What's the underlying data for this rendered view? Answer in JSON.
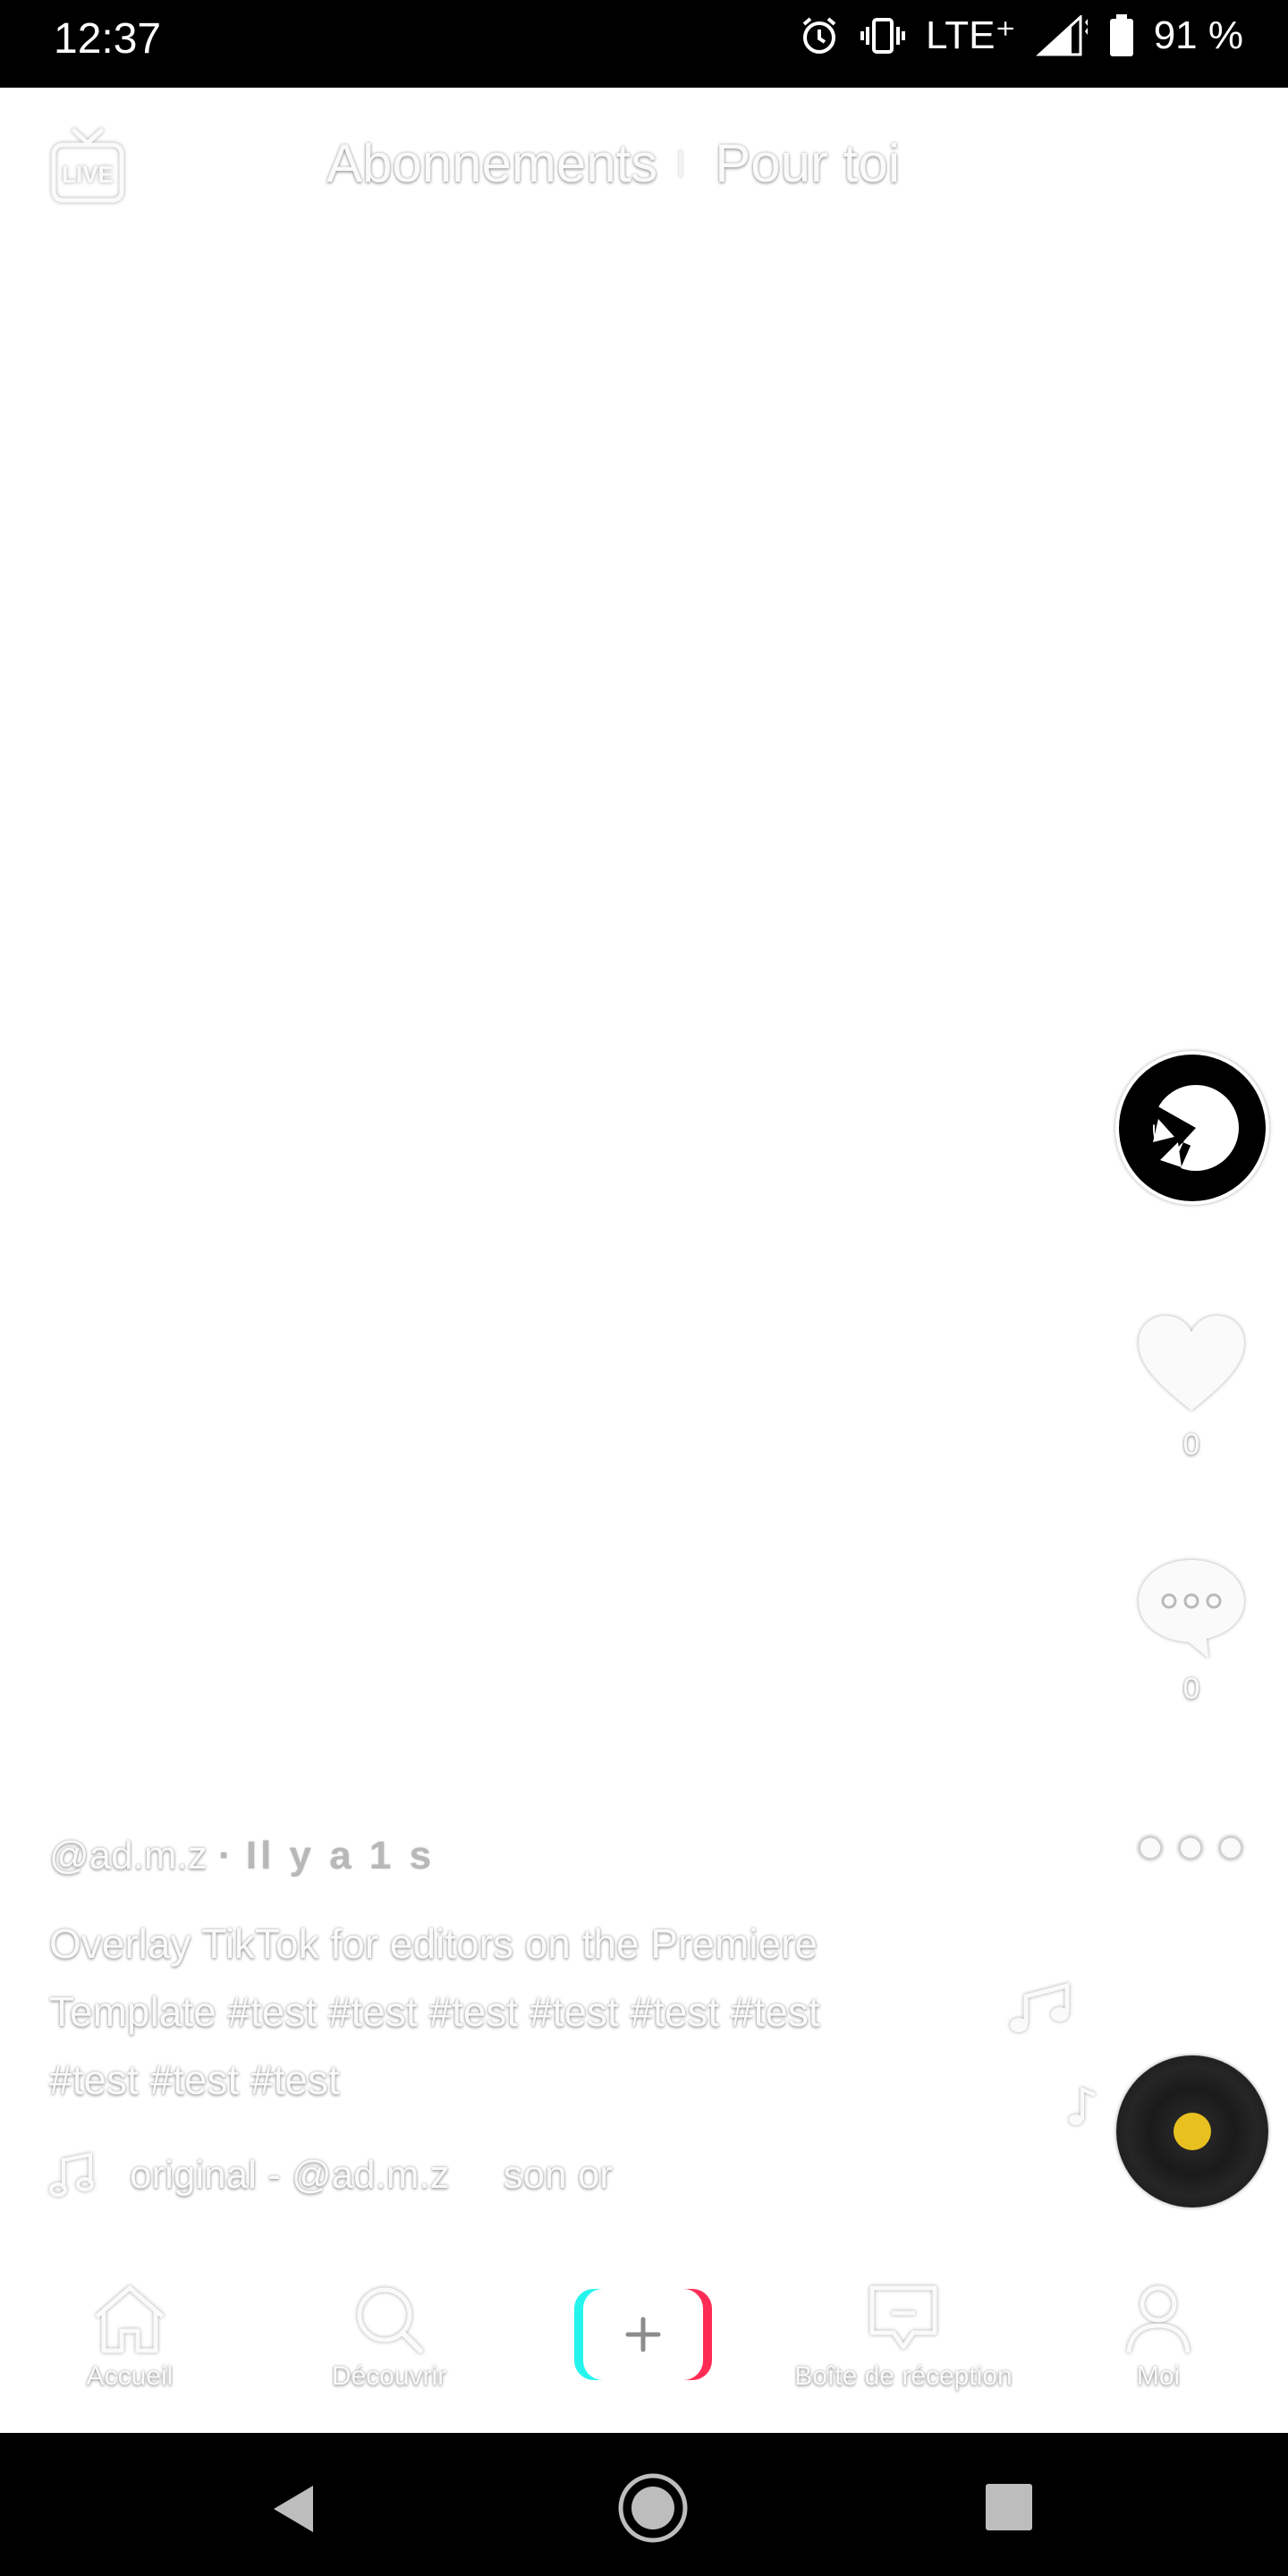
{
  "status_bar": {
    "time": "12:37",
    "network": "LTE⁺",
    "battery": "91 %",
    "icons": [
      "alarm-icon",
      "vibrate-icon",
      "signal-icon",
      "battery-icon"
    ]
  },
  "header": {
    "live_icon": "live-tv-icon",
    "live_label": "LIVE",
    "tab_following": "Abonnements",
    "tab_for_you": "Pour toi"
  },
  "rail": {
    "like_count": "0",
    "comment_count": "0"
  },
  "post": {
    "author": "@ad.m.z",
    "separator": "·",
    "time_ago": "Il y a 1 s",
    "caption_line1": "Overlay TikTok for editors on the Premiere",
    "caption_line2": "Template #test #test #test #test #test #test",
    "caption_line3": "#test #test #test",
    "sound_text": "original - @ad.m.z",
    "sound_text_trail": "son or"
  },
  "bottom_nav": {
    "home": "Accueil",
    "discover": "Découvrir",
    "inbox": "Boîte de réception",
    "me": "Moi"
  },
  "colors": {
    "disc_center": "#e8c020",
    "create_cyan": "#25f4ee",
    "create_pink": "#fe2c55"
  }
}
